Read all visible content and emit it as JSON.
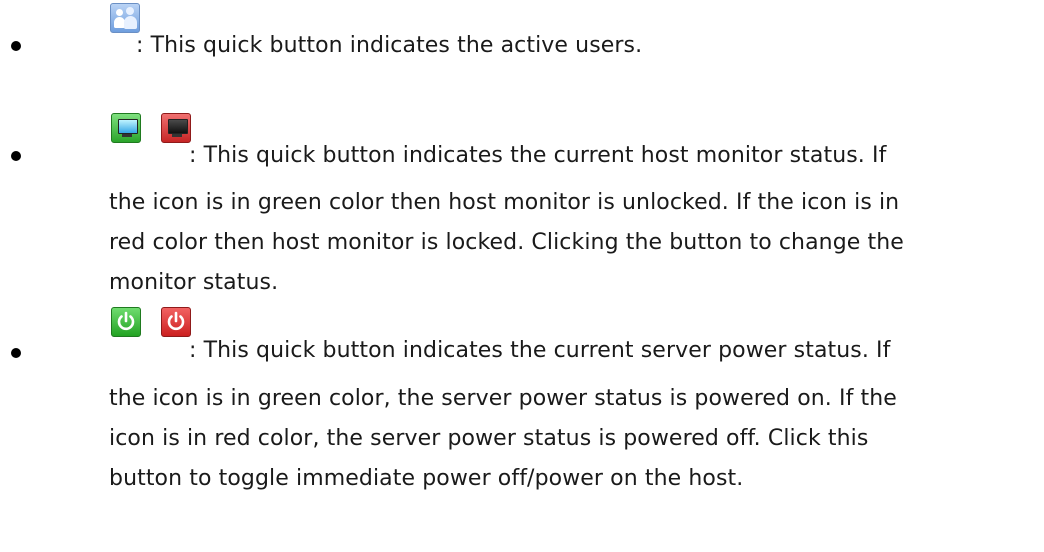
{
  "items": [
    {
      "icons": [
        "users-icon"
      ],
      "lines": [
        ": This quick button indicates the active users."
      ]
    },
    {
      "icons": [
        "monitor-unlocked-icon",
        "monitor-locked-icon"
      ],
      "lines": [
        ": This quick button indicates the current host monitor status. If",
        "the icon is in green color then host monitor is unlocked. If the icon is in",
        "red color then host monitor is locked. Clicking the button to change the",
        "monitor status."
      ]
    },
    {
      "icons": [
        "power-on-icon",
        "power-off-icon"
      ],
      "lines": [
        ": This quick button indicates the current server power status. If",
        "the icon is in green color, the server power status is powered on. If the",
        "icon is in red color, the server power status is powered off. Click this",
        "button to toggle immediate power off/power on the host."
      ]
    }
  ],
  "colors": {
    "text": "#1a1a1a",
    "green": "#2aa42a",
    "red": "#c62525",
    "blue": "#6f9ede"
  }
}
